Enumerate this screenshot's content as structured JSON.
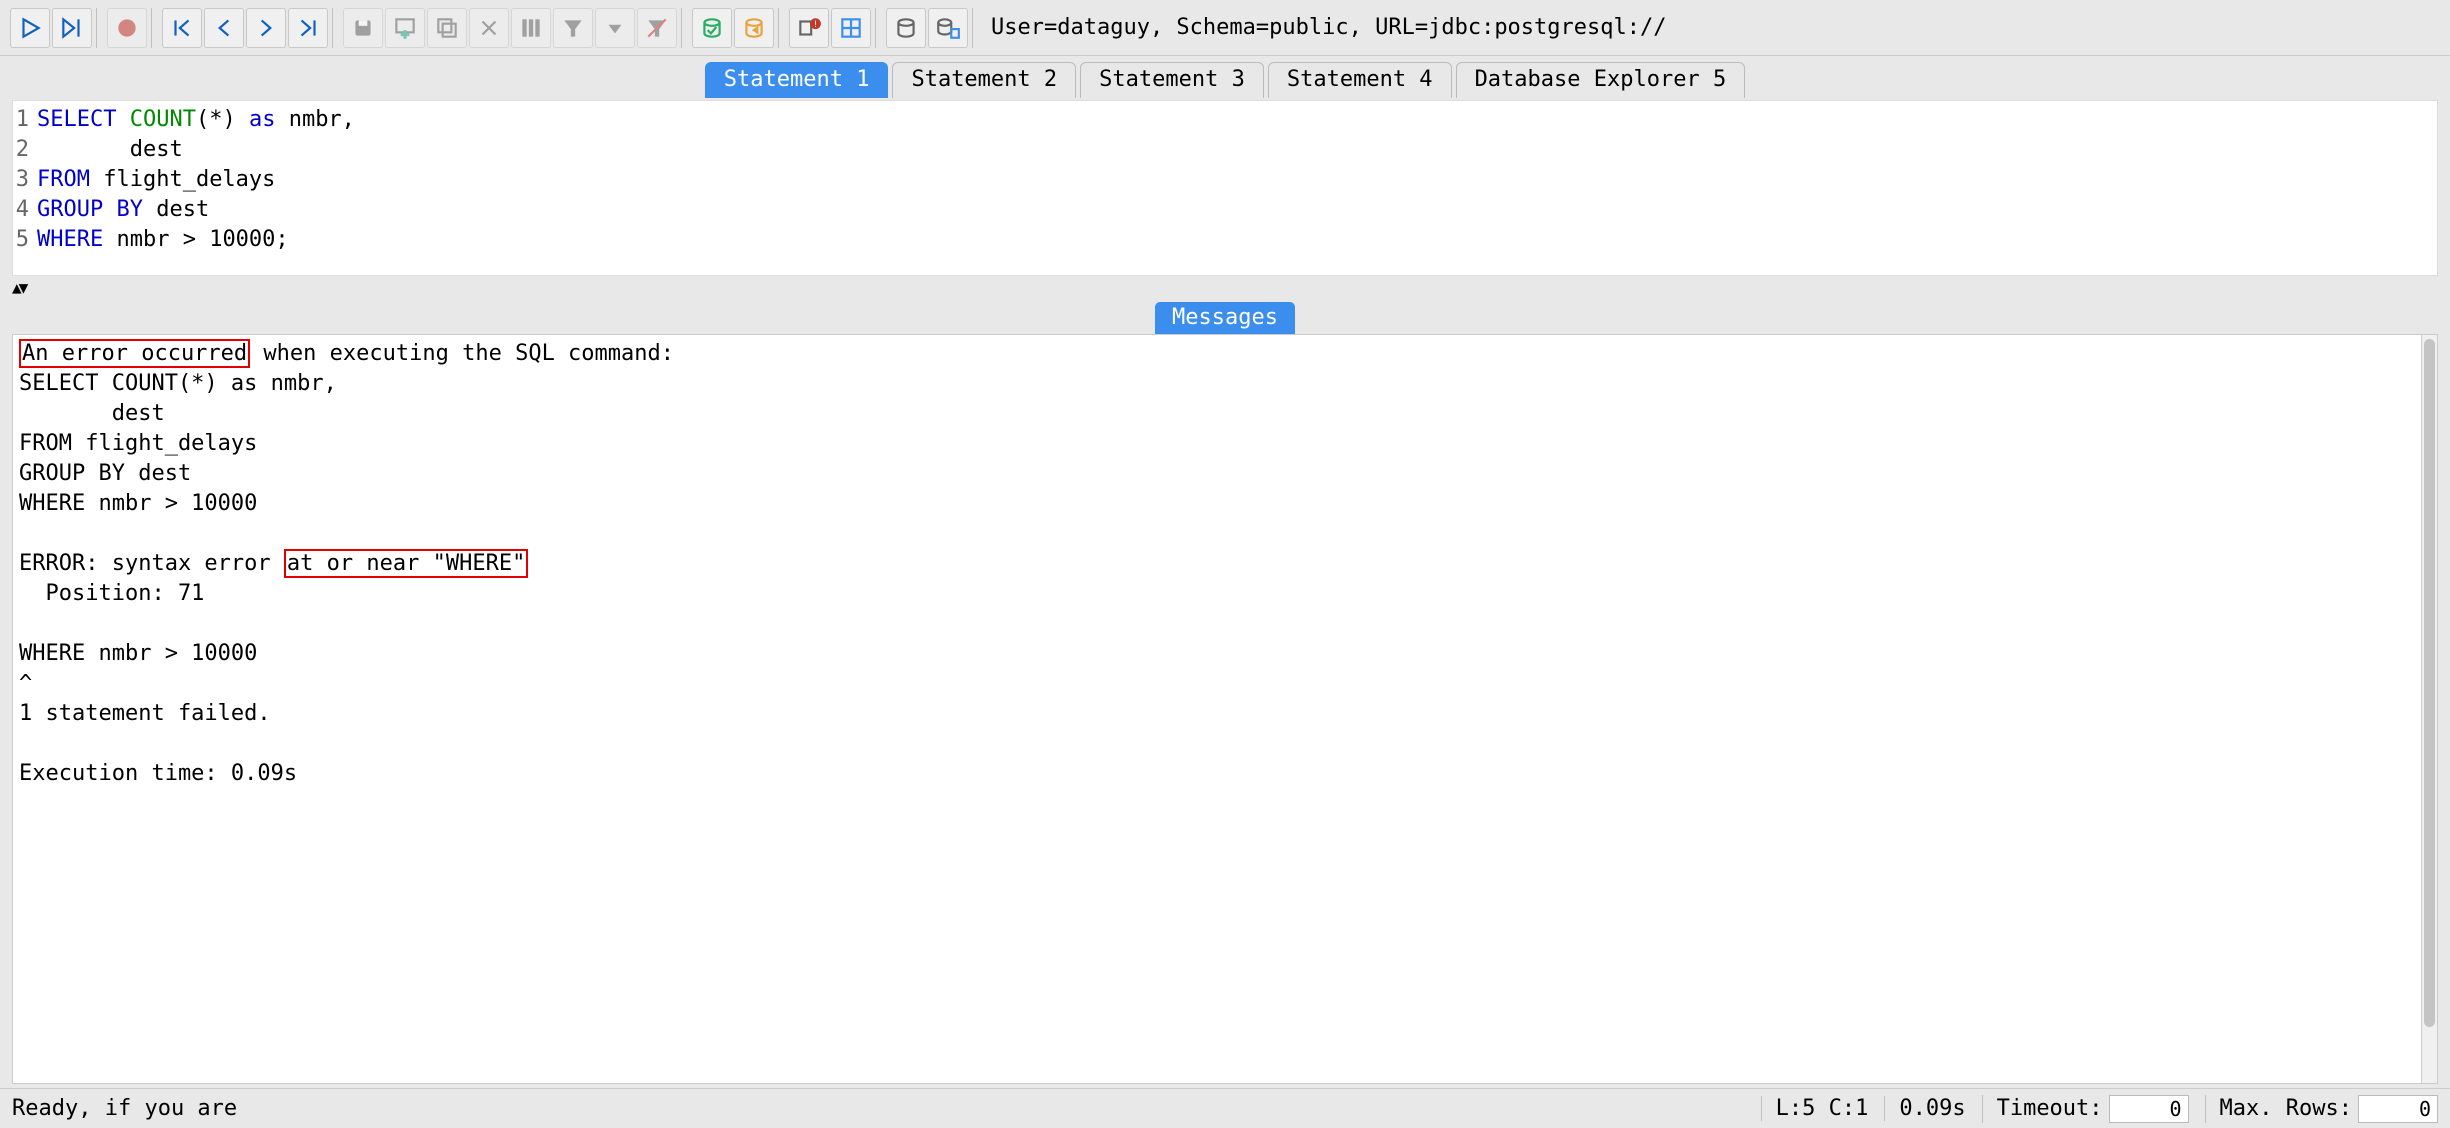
{
  "connection_info": "User=dataguy, Schema=public, URL=jdbc:postgresql://",
  "tabs": [
    {
      "label": "Statement 1",
      "active": true
    },
    {
      "label": "Statement 2",
      "active": false
    },
    {
      "label": "Statement 3",
      "active": false
    },
    {
      "label": "Statement 4",
      "active": false
    },
    {
      "label": "Database Explorer 5",
      "active": false
    }
  ],
  "editor": {
    "line_numbers": [
      "1",
      "2",
      "3",
      "4",
      "5"
    ],
    "lines": [
      [
        {
          "t": "SELECT",
          "c": "kw-blue"
        },
        {
          "t": " ",
          "c": "kw-plain"
        },
        {
          "t": "COUNT",
          "c": "kw-green"
        },
        {
          "t": "(*) ",
          "c": "kw-plain"
        },
        {
          "t": "as",
          "c": "kw-blue"
        },
        {
          "t": " nmbr,",
          "c": "kw-plain"
        }
      ],
      [
        {
          "t": "       dest",
          "c": "kw-plain"
        }
      ],
      [
        {
          "t": "FROM",
          "c": "kw-blue"
        },
        {
          "t": " flight_delays",
          "c": "kw-plain"
        }
      ],
      [
        {
          "t": "GROUP BY",
          "c": "kw-blue"
        },
        {
          "t": " dest",
          "c": "kw-plain"
        }
      ],
      [
        {
          "t": "WHERE",
          "c": "kw-blue"
        },
        {
          "t": " nmbr > 10000;",
          "c": "kw-plain"
        }
      ]
    ]
  },
  "messages_tab": "Messages",
  "messages": {
    "err_lead": "An error occurred",
    "err_tail": " when executing the SQL command:",
    "echo": "SELECT COUNT(*) as nmbr,\n       dest\nFROM flight_delays\nGROUP BY dest\nWHERE nmbr > 10000",
    "error_prefix": "ERROR: syntax error ",
    "error_box": "at or near \"WHERE\"",
    "error_pos": "  Position: 71",
    "where_echo": "WHERE nmbr > 10000",
    "caret": "^",
    "failed": "1 statement failed.",
    "exec_time": "Execution time: 0.09s"
  },
  "status": {
    "ready": "Ready, if you are",
    "linecol": "L:5 C:1",
    "time": "0.09s",
    "timeout_label": "Timeout:",
    "timeout_value": "0",
    "maxrows_label": "Max. Rows:",
    "maxrows_value": "0"
  },
  "colors": {
    "tab_active": "#3b8eed",
    "kw_blue": "#0000cc",
    "kw_green": "#008800",
    "error_red": "#e00000"
  }
}
